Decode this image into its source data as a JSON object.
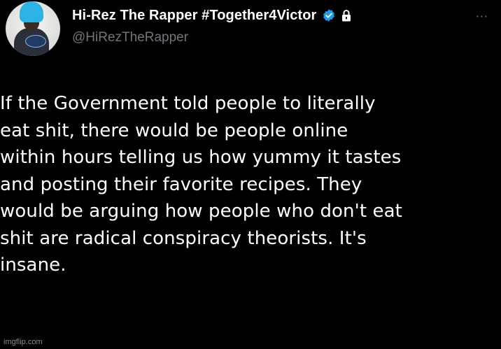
{
  "tweet": {
    "display_name": "Hi-Rez The Rapper #Together4Victor",
    "handle": "@HiRezTheRapper",
    "text": "If the Government told people to literally\neat shit, there would be people online\nwithin hours telling us how yummy it tastes\nand posting their favorite recipes. They\nwould be arguing how people who don't eat\nshit are radical conspiracy theorists. It's\ninsane.",
    "more_icon": "···"
  },
  "icons": {
    "avatar": "avatar",
    "verified": "verified-icon",
    "lock": "lock-icon",
    "more": "more-options-icon"
  },
  "colors": {
    "background": "#000000",
    "text": "#ffffff",
    "handle": "#71767b",
    "verified": "#1d9bf0",
    "watermark": "#8a8a8a"
  },
  "watermark": "imgflip.com"
}
